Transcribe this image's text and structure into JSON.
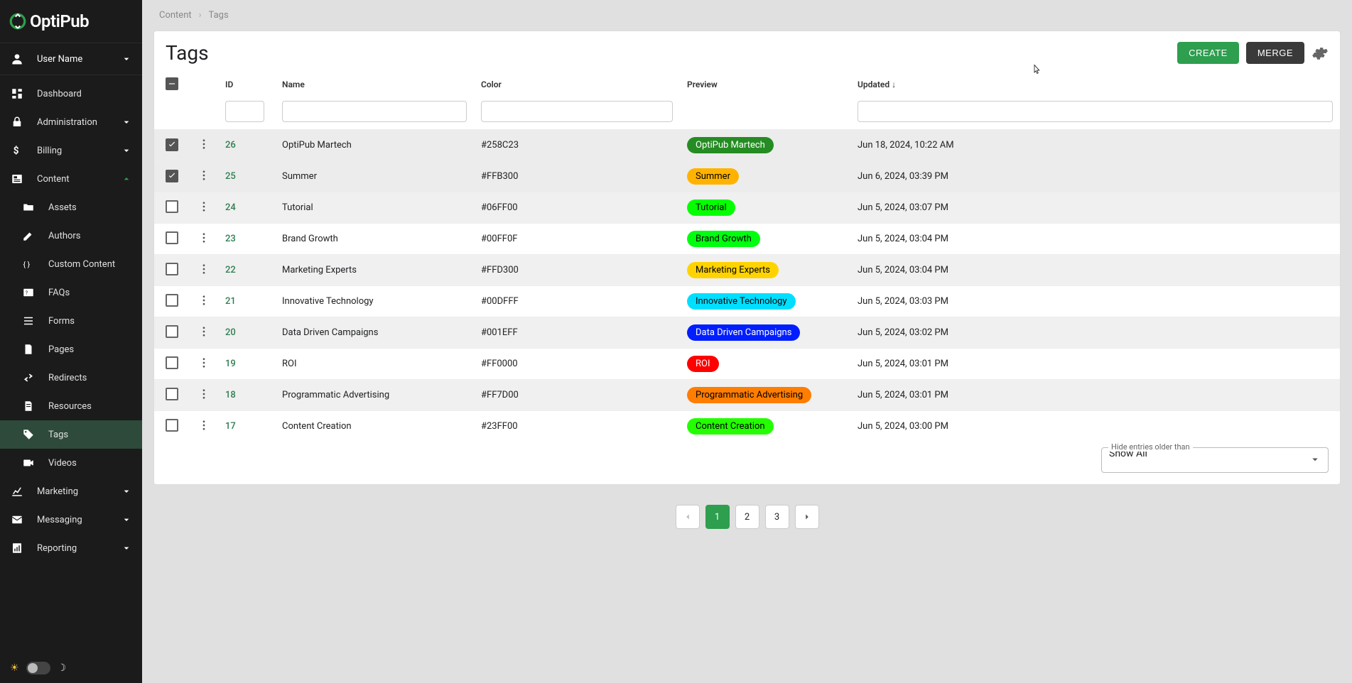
{
  "brand": "OptiPub",
  "user": {
    "name": "User Name"
  },
  "nav": {
    "dashboard": "Dashboard",
    "administration": "Administration",
    "billing": "Billing",
    "content": "Content",
    "content_items": {
      "assets": "Assets",
      "authors": "Authors",
      "custom_content": "Custom Content",
      "faqs": "FAQs",
      "forms": "Forms",
      "pages": "Pages",
      "redirects": "Redirects",
      "resources": "Resources",
      "tags": "Tags",
      "videos": "Videos"
    },
    "marketing": "Marketing",
    "messaging": "Messaging",
    "reporting": "Reporting"
  },
  "breadcrumbs": {
    "content": "Content",
    "tags": "Tags"
  },
  "page": {
    "title": "Tags",
    "create": "Create",
    "merge": "Merge"
  },
  "columns": {
    "id": "ID",
    "name": "Name",
    "color": "Color",
    "preview": "Preview",
    "updated": "Updated"
  },
  "rows": [
    {
      "selected": true,
      "id": "26",
      "name": "OptiPub Martech",
      "color": "#258C23",
      "preview_bg": "#258C23",
      "preview_light": true,
      "updated": "Jun 18, 2024, 10:22 AM"
    },
    {
      "selected": true,
      "id": "25",
      "name": "Summer",
      "color": "#FFB300",
      "preview_bg": "#FFB300",
      "preview_light": false,
      "updated": "Jun 6, 2024, 03:39 PM"
    },
    {
      "selected": false,
      "id": "24",
      "name": "Tutorial",
      "color": "#06FF00",
      "preview_bg": "#06FF00",
      "preview_light": false,
      "updated": "Jun 5, 2024, 03:07 PM"
    },
    {
      "selected": false,
      "id": "23",
      "name": "Brand Growth",
      "color": "#00FF0F",
      "preview_bg": "#00FF0F",
      "preview_light": false,
      "updated": "Jun 5, 2024, 03:04 PM"
    },
    {
      "selected": false,
      "id": "22",
      "name": "Marketing Experts",
      "color": "#FFD300",
      "preview_bg": "#FFD300",
      "preview_light": false,
      "updated": "Jun 5, 2024, 03:04 PM"
    },
    {
      "selected": false,
      "id": "21",
      "name": "Innovative Technology",
      "color": "#00DFFF",
      "preview_bg": "#00DFFF",
      "preview_light": false,
      "updated": "Jun 5, 2024, 03:03 PM"
    },
    {
      "selected": false,
      "id": "20",
      "name": "Data Driven Campaigns",
      "color": "#001EFF",
      "preview_bg": "#001EFF",
      "preview_light": true,
      "updated": "Jun 5, 2024, 03:02 PM"
    },
    {
      "selected": false,
      "id": "19",
      "name": "ROI",
      "color": "#FF0000",
      "preview_bg": "#FF0000",
      "preview_light": true,
      "updated": "Jun 5, 2024, 03:01 PM"
    },
    {
      "selected": false,
      "id": "18",
      "name": "Programmatic Advertising",
      "color": "#FF7D00",
      "preview_bg": "#FF7D00",
      "preview_light": false,
      "updated": "Jun 5, 2024, 03:01 PM"
    },
    {
      "selected": false,
      "id": "17",
      "name": "Content Creation",
      "color": "#23FF00",
      "preview_bg": "#23FF00",
      "preview_light": false,
      "updated": "Jun 5, 2024, 03:00 PM"
    }
  ],
  "hide_entries": {
    "label": "Hide entries older than",
    "value": "Show All"
  },
  "pagination": {
    "pages": [
      "1",
      "2",
      "3"
    ],
    "active": "1"
  }
}
